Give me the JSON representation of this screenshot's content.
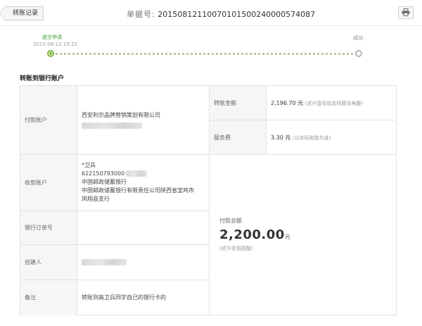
{
  "header": {
    "back_label": "转账记录",
    "receipt_label": "单据号:",
    "receipt_number": "20150812110070101500240000574087"
  },
  "progress": {
    "step1_label": "提交申请",
    "step1_time": "2015-08-12 15:22",
    "step2_label": "成功",
    "accent_color": "#7ab33e"
  },
  "section_title": "转账到银行账户",
  "payer": {
    "label": "付款账户",
    "company": "西安利尔品牌营销策划有限公司"
  },
  "amount": {
    "label": "转账金额",
    "value": "2,196.70",
    "unit": "元",
    "words": "(贰仟壹佰玖拾陆圆柒角整)"
  },
  "fee": {
    "label": "服务费",
    "value": "3.30",
    "unit": "元",
    "note": "(以实际收取为准)"
  },
  "payee": {
    "label": "收款账户",
    "name": "*卫兵",
    "account": "622150793000",
    "bank": "中国邮政储蓄银行",
    "branch_line1": "中国邮政储蓄银行有限责任公司陕西省宝鸡市",
    "branch_line2": "凤翔县支行"
  },
  "order": {
    "label": "银行订单号",
    "value": ""
  },
  "creator": {
    "label": "创建人"
  },
  "remark": {
    "label": "备注",
    "value": "转账到高卫兵同学自己的银行卡的"
  },
  "total": {
    "label": "付款总额",
    "value": "2,200.00",
    "unit": "元",
    "words": "(贰仟贰佰圆整)"
  }
}
